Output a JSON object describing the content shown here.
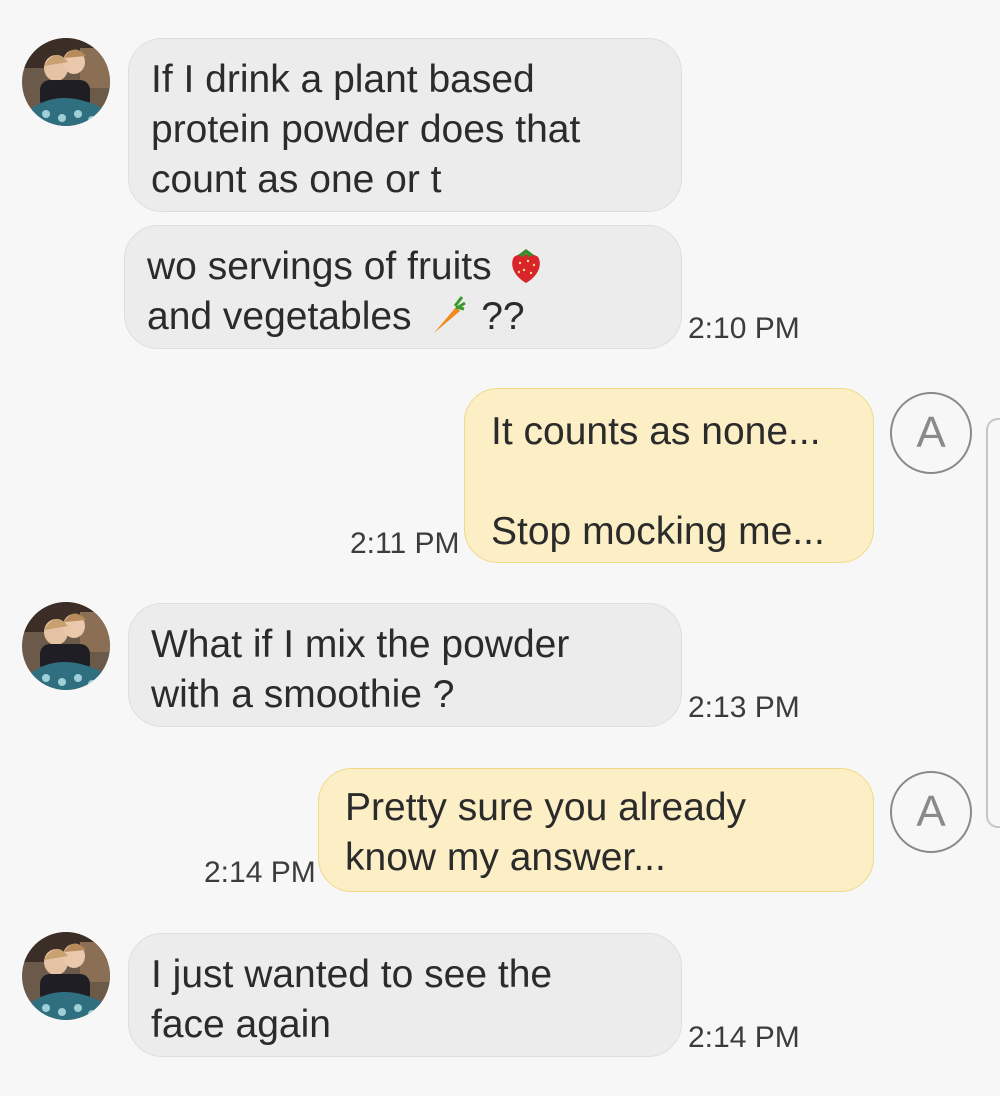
{
  "conversation": {
    "messages": [
      {
        "direction": "incoming",
        "parts": [
          {
            "text": "If I drink a plant based\nprotein powder does that\ncount as one or t"
          },
          {
            "text_before": "wo servings of fruits",
            "emoji1": "strawberry-emoji",
            "text_mid": "and vegetables",
            "emoji2": "carrot-emoji",
            "text_after": "??"
          }
        ],
        "time": "2:10 PM"
      },
      {
        "direction": "outgoing",
        "text": "It counts as none...\n\nStop mocking me...",
        "time": "2:11 PM",
        "read_badge": "A"
      },
      {
        "direction": "incoming",
        "text": "What if I mix the powder\nwith a smoothie  ?",
        "time": "2:13 PM"
      },
      {
        "direction": "outgoing",
        "text": " Pretty sure you already\nknow my answer...",
        "time": "2:14 PM",
        "read_badge": "A"
      },
      {
        "direction": "incoming",
        "text": "I just wanted to see the\nface again",
        "time": "2:14 PM"
      }
    ]
  },
  "colors": {
    "background": "#f7f7f7",
    "incoming_bubble": "#ececec",
    "outgoing_bubble": "#fcefc6",
    "outgoing_border": "#efd98a"
  },
  "icons": {
    "avatar": "contact-photo-icon",
    "read_badge": "read-receipt-icon"
  }
}
